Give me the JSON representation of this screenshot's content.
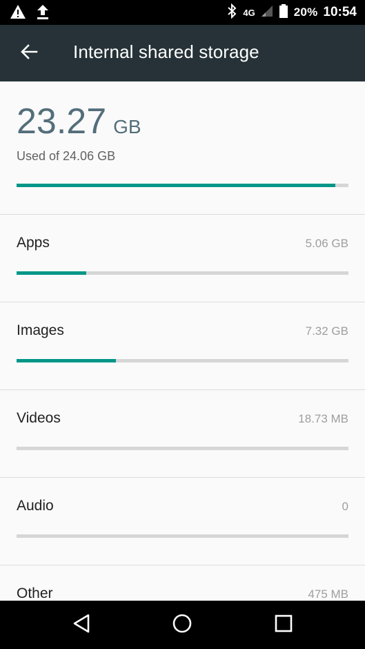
{
  "status_bar": {
    "icons": [
      "warning-icon",
      "upload-icon",
      "bluetooth-icon",
      "signal-icon",
      "battery-icon"
    ],
    "network": "4G",
    "battery": "20%",
    "time": "10:54"
  },
  "app_bar": {
    "back_icon": "arrow-back-icon",
    "title": "Internal shared storage"
  },
  "summary": {
    "used_value": "23.27",
    "used_unit": "GB",
    "caption": "Used of 24.06 GB",
    "used_fraction": 0.96
  },
  "categories": [
    {
      "label": "Apps",
      "size": "5.06 GB",
      "fraction": 0.21
    },
    {
      "label": "Images",
      "size": "7.32 GB",
      "fraction": 0.3
    },
    {
      "label": "Videos",
      "size": "18.73 MB",
      "fraction": 0.0
    },
    {
      "label": "Audio",
      "size": "0",
      "fraction": 0.0
    },
    {
      "label": "Other",
      "size": "475 MB",
      "fraction": 0.02
    }
  ],
  "nav_bar": {
    "icons": [
      "back-triangle-icon",
      "home-circle-icon",
      "recents-square-icon"
    ]
  },
  "colors": {
    "app_bar": "#263238",
    "accent": "#009688",
    "used_value": "#546e7a"
  }
}
